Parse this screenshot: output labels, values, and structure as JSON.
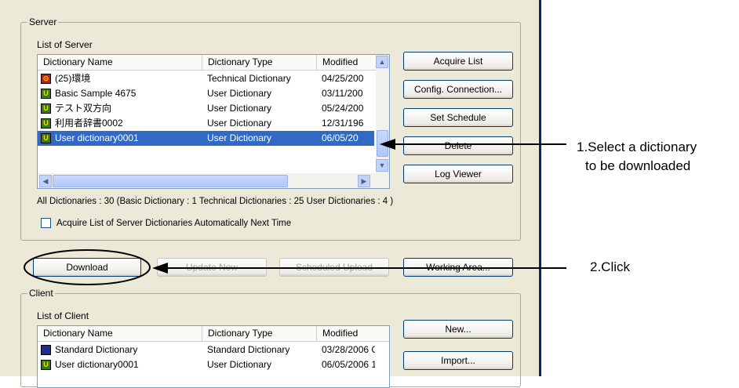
{
  "server": {
    "group_label": "Server",
    "list_label": "List of Server",
    "columns": [
      "Dictionary Name",
      "Dictionary Type",
      "Modified"
    ],
    "rows": [
      {
        "icon": "technical-dictionary-icon",
        "name": "(25)環境",
        "type": "Technical Dictionary",
        "modified": "04/25/200",
        "selected": false
      },
      {
        "icon": "user-dictionary-icon",
        "name": "Basic Sample 4675",
        "type": "User Dictionary",
        "modified": "03/11/200",
        "selected": false
      },
      {
        "icon": "user-dictionary-icon",
        "name": "テスト双方向",
        "type": "User Dictionary",
        "modified": "05/24/200",
        "selected": false
      },
      {
        "icon": "user-dictionary-icon",
        "name": "利用者辞書0002",
        "type": "User Dictionary",
        "modified": "12/31/196",
        "selected": false
      },
      {
        "icon": "user-dictionary-icon",
        "name": "User dictionary0001",
        "type": "User Dictionary",
        "modified": "06/05/20",
        "selected": true
      }
    ],
    "buttons": {
      "acquire_list": "Acquire List",
      "config_connection": "Config. Connection...",
      "set_schedule": "Set Schedule",
      "delete": "Delete",
      "log_viewer": "Log Viewer"
    },
    "counts_text": "All Dictionaries :  30    (Basic Dictionary :  1  Technical Dictionaries :  25  User Dictionaries :  4      )",
    "auto_acquire_label": "Acquire List of Server Dictionaries Automatically Next Time",
    "auto_acquire_checked": false
  },
  "actions": {
    "download": "Download",
    "update_now": "Update Now",
    "scheduled_upload": "Scheduled Upload",
    "working_area": "Working Area..."
  },
  "client": {
    "group_label": "Client",
    "list_label": "List of Client",
    "columns": [
      "Dictionary Name",
      "Dictionary Type",
      "Modified"
    ],
    "rows": [
      {
        "icon": "standard-dictionary-icon",
        "name": "Standard Dictionary",
        "type": "Standard Dictionary",
        "modified": "03/28/2006 C"
      },
      {
        "icon": "user-dictionary-icon",
        "name": "User dictionary0001",
        "type": "User Dictionary",
        "modified": "06/05/2006 1"
      }
    ],
    "buttons": {
      "new": "New...",
      "import": "Import..."
    }
  },
  "annotations": {
    "step1_line1": "1.Select a dictionary",
    "step1_line2": "to be downloaded",
    "step2": "2.Click"
  }
}
